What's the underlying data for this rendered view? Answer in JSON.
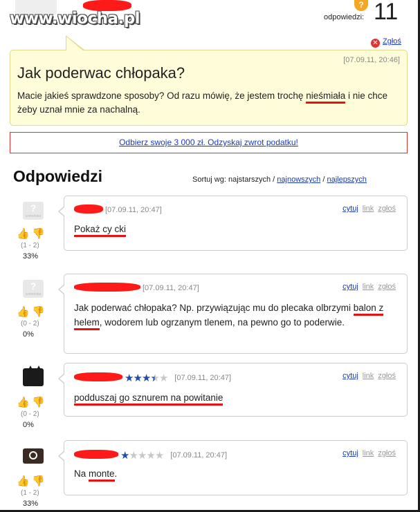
{
  "site": {
    "watermark": "www.wiocha.pl"
  },
  "header": {
    "answers_label": "odpowiedzi:",
    "answers_count": "11",
    "report_label": "Zgłoś"
  },
  "question": {
    "date": "[07.09.11, 20:46]",
    "title": "Jak poderwac chłopaka?",
    "body_1": "Macie jakieś sprawdzone sposoby? Od razu mówię, że jestem trochę ",
    "body_highlight": "nieśmiała",
    "body_2": " i nie chce żeby uznał mnie za nachalną."
  },
  "promo": {
    "text": "Odbierz swoje 3 000 zł. Odzyskaj zwrot podatku!"
  },
  "answers_section": {
    "title": "Odpowiedzi",
    "sort_prefix": "Sortuj wg: najstarszych /",
    "sort_newest": "najnowszych",
    "sort_sep": "/",
    "sort_best": "najlepszych"
  },
  "actions": {
    "quote": "cytuj",
    "link": "link",
    "report": "zgłoś"
  },
  "answers": [
    {
      "date": "[07.09.11, 20:47]",
      "text": "Pokaż cy cki",
      "vote_range": "(1 - 2)",
      "vote_pct": "33%",
      "stars": null
    },
    {
      "date": "[07.09.11, 20:47]",
      "text_1": "Jak poderwać chłopaka? Np. przywiązując mu do plecaka olbrzymi ",
      "text_highlight": "balon z helem",
      "text_2": ", wodorem lub ogrzanym tlenem, na pewno go to poderwie.",
      "vote_range": "(0 - 2)",
      "vote_pct": "0%",
      "stars": null
    },
    {
      "date": "[07.09.11, 20:47]",
      "text": "podduszaj go sznurem na powitanie",
      "vote_range": "(0 - 2)",
      "vote_pct": "0%",
      "stars": 3.5
    },
    {
      "date": "[07.09.11, 20:47]",
      "text_1": "Na ",
      "text_highlight": "monte",
      "text_2": ".",
      "vote_range": "(1 - 2)",
      "vote_pct": "33%",
      "stars": 1
    }
  ],
  "colors": {
    "accent_link": "#1a3bb8",
    "question_bg": "#fffcd9",
    "promo_border": "#dd3333",
    "star_on": "#1f4bb0",
    "thumb_up": "#d44bb5",
    "thumb_down": "#e8a21a"
  }
}
